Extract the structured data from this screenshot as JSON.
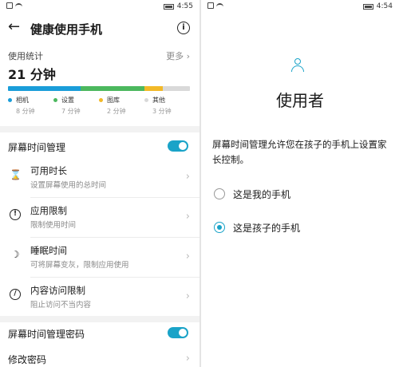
{
  "left_status": {
    "time": "4:55"
  },
  "right_status": {
    "time": "4:54"
  },
  "left": {
    "title": "健康使用手机",
    "usage_label": "使用统计",
    "more": "更多",
    "total": "21 分钟",
    "usage_breakdown": [
      {
        "name": "相机",
        "time": "8 分钟",
        "minutes": 8,
        "color": "#1a9dd9"
      },
      {
        "name": "设置",
        "time": "7 分钟",
        "minutes": 7,
        "color": "#4cb85e"
      },
      {
        "name": "图库",
        "time": "2 分钟",
        "minutes": 2,
        "color": "#f2b928"
      },
      {
        "name": "其他",
        "time": "3 分钟",
        "minutes": 3,
        "color": "#d9d9d9"
      }
    ],
    "toggle1_label": "屏幕时间管理",
    "items": [
      {
        "title": "可用时长",
        "sub": "设置屏幕使用的总时间",
        "icon": "hourglass-icon"
      },
      {
        "title": "应用限制",
        "sub": "限制使用时间",
        "icon": "alert-circle-icon"
      },
      {
        "title": "睡眠时间",
        "sub": "可将屏幕变灰，限制应用使用",
        "icon": "moon-icon"
      },
      {
        "title": "内容访问限制",
        "sub": "阻止访问不当内容",
        "icon": "block-icon"
      }
    ],
    "toggle2_label": "屏幕时间管理密码",
    "change_password": "修改密码"
  },
  "right": {
    "title": "使用者",
    "description": "屏幕时间管理允许您在孩子的手机上设置家长控制。",
    "options": [
      {
        "label": "这是我的手机",
        "selected": false
      },
      {
        "label": "这是孩子的手机",
        "selected": true
      }
    ]
  },
  "colors": {
    "accent": "#1aa3c8"
  }
}
